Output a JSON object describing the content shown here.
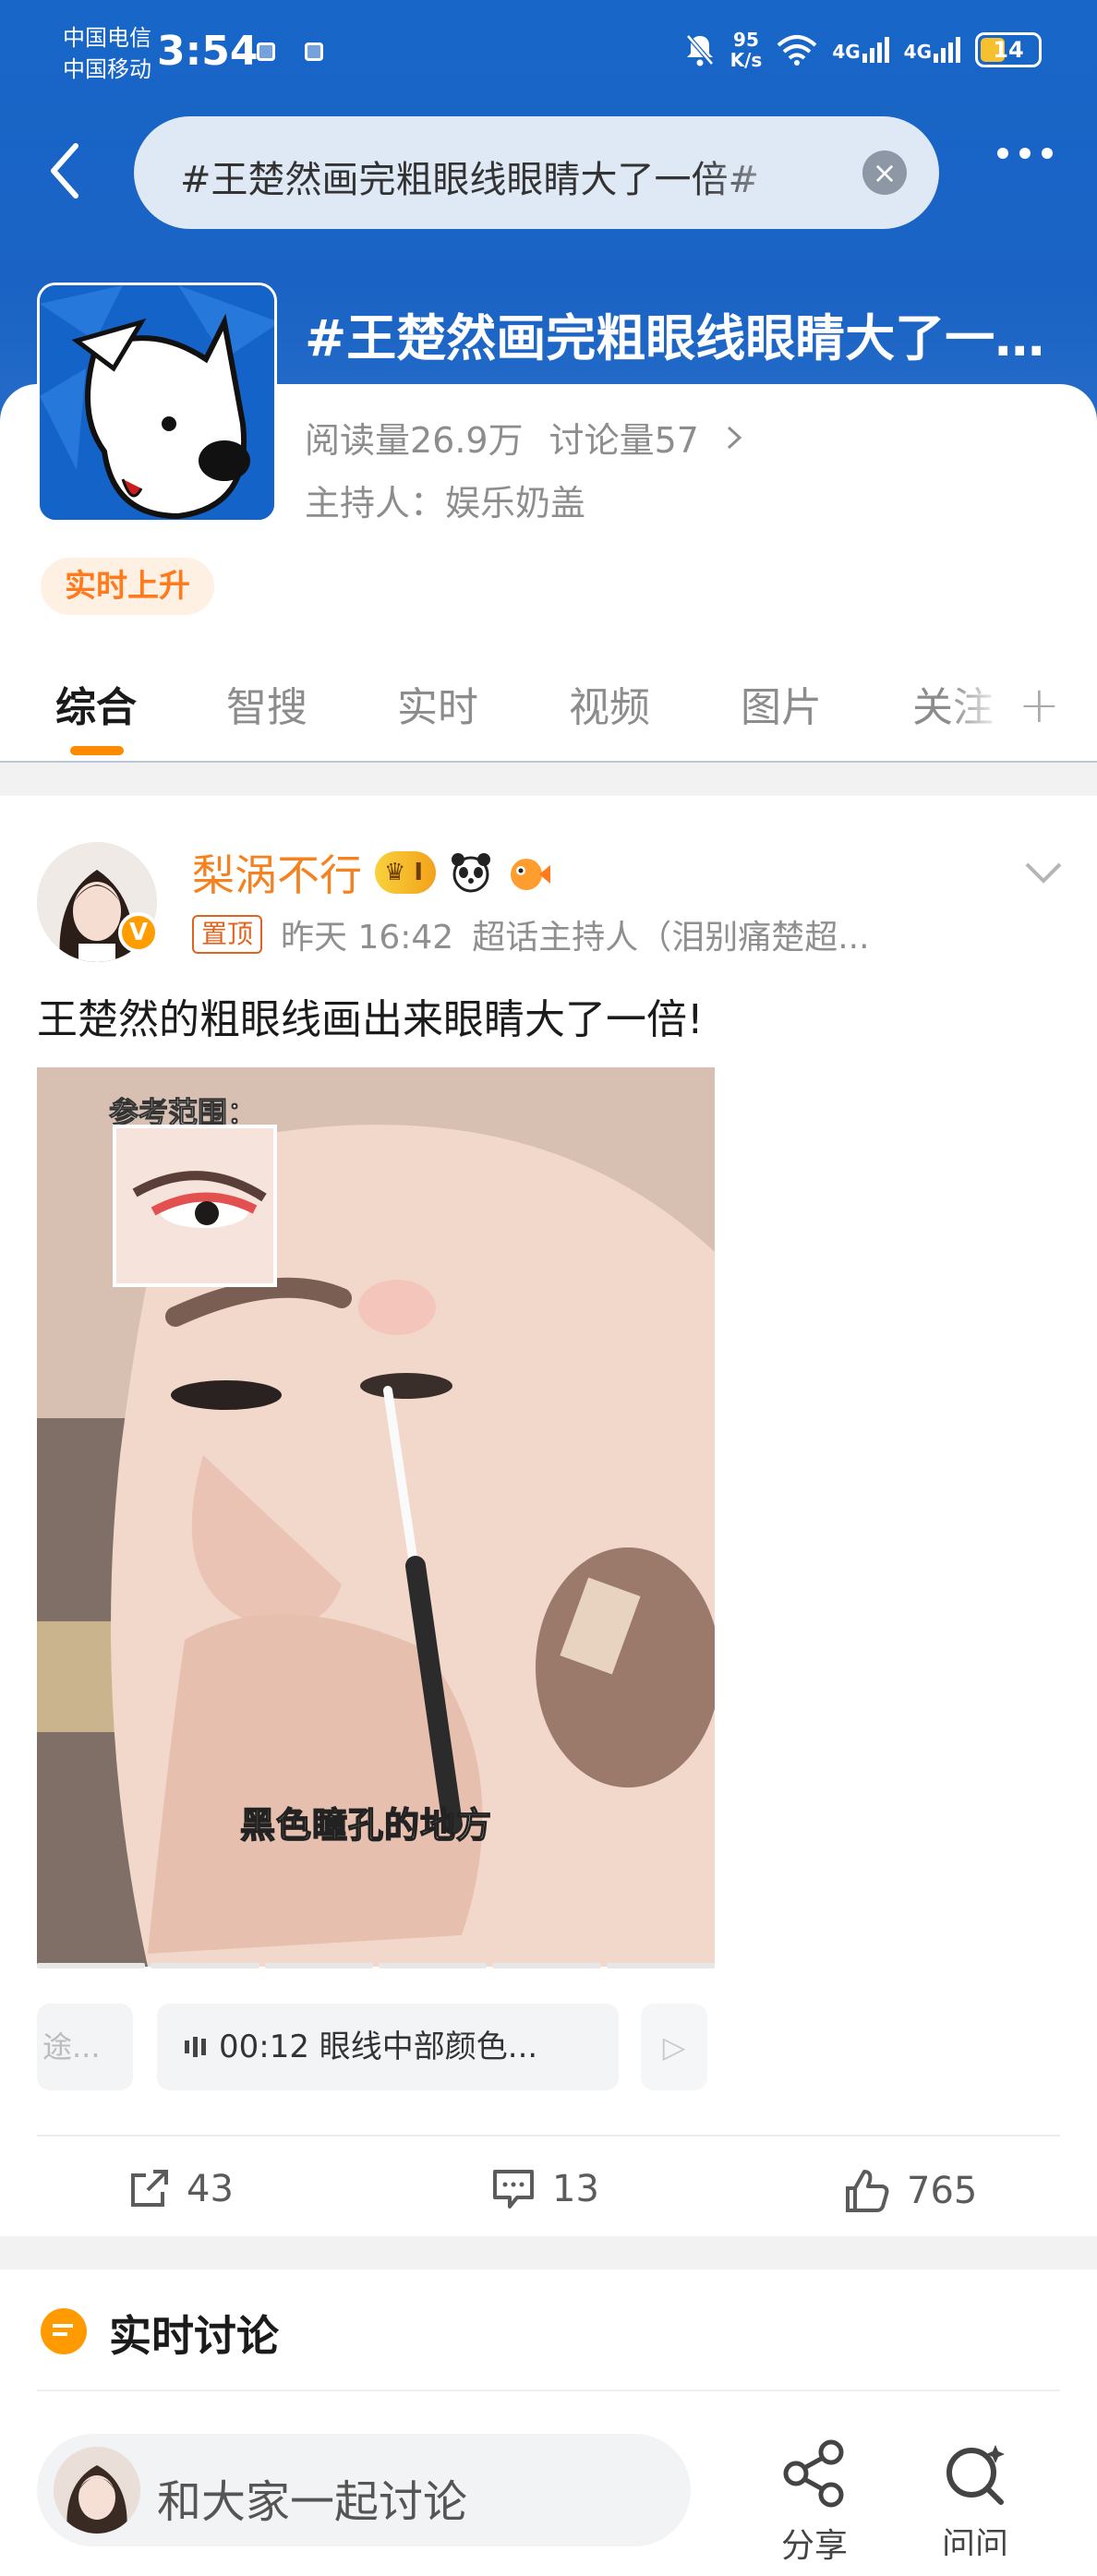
{
  "status_bar": {
    "carrier_1": "中国电信",
    "carrier_2": "中国移动",
    "time": "3:54",
    "net_speed_value": "95",
    "net_speed_unit": "K/s",
    "sig1": "4G",
    "sig2": "4G",
    "battery": "14"
  },
  "search": {
    "query": "#王楚然画完粗眼线眼睛大了一倍#"
  },
  "topic": {
    "title": "#王楚然画完粗眼线眼睛大了一倍#",
    "reads": "阅读量26.9万",
    "discussions": "讨论量57",
    "host": "主持人：娱乐奶盖",
    "badge": "实时上升"
  },
  "tabs": [
    "综合",
    "智搜",
    "实时",
    "视频",
    "图片",
    "关注"
  ],
  "post": {
    "username": "梨涡不行",
    "level_badge": "I",
    "pin_label": "置顶",
    "time": "昨天 16:42",
    "source": "超话主持人（泪别痛楚超...",
    "text": "王楚然的粗眼线画出来眼睛大了一倍!",
    "media": {
      "ref_label": "参考范围：",
      "caption_prefix": "黑色瞳孔",
      "caption_suffix": "的地方"
    },
    "chip_left": "途...",
    "chip_main": "00:12 眼线中部颜色...",
    "actions": {
      "share_count": "43",
      "comment_count": "13",
      "like_count": "765"
    }
  },
  "live_section": {
    "title": "实时讨论"
  },
  "bottom_bar": {
    "compose_placeholder": "和大家一起讨论",
    "share_label": "分享",
    "search_label": "问问"
  },
  "colors": {
    "hero_blue": "#1766c8",
    "accent_orange": "#ff8a00",
    "username_orange": "#f58220"
  }
}
